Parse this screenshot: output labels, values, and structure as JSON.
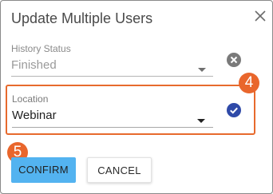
{
  "dialog": {
    "title": "Update Multiple Users",
    "close_icon": "close-icon"
  },
  "history_status": {
    "label": "History Status",
    "value": "Finished",
    "clear_icon": "clear-x-icon"
  },
  "location": {
    "label": "Location",
    "value": "Webinar",
    "check_icon": "check-circle-icon"
  },
  "annotations": {
    "step_location": "4",
    "step_confirm": "5"
  },
  "actions": {
    "confirm_label": "CONFIRM",
    "cancel_label": "CANCEL"
  },
  "colors": {
    "accent": "#53b3f0",
    "highlight": "#e76a2d",
    "check": "#2f4aa8",
    "clear": "#7a7a7a"
  }
}
